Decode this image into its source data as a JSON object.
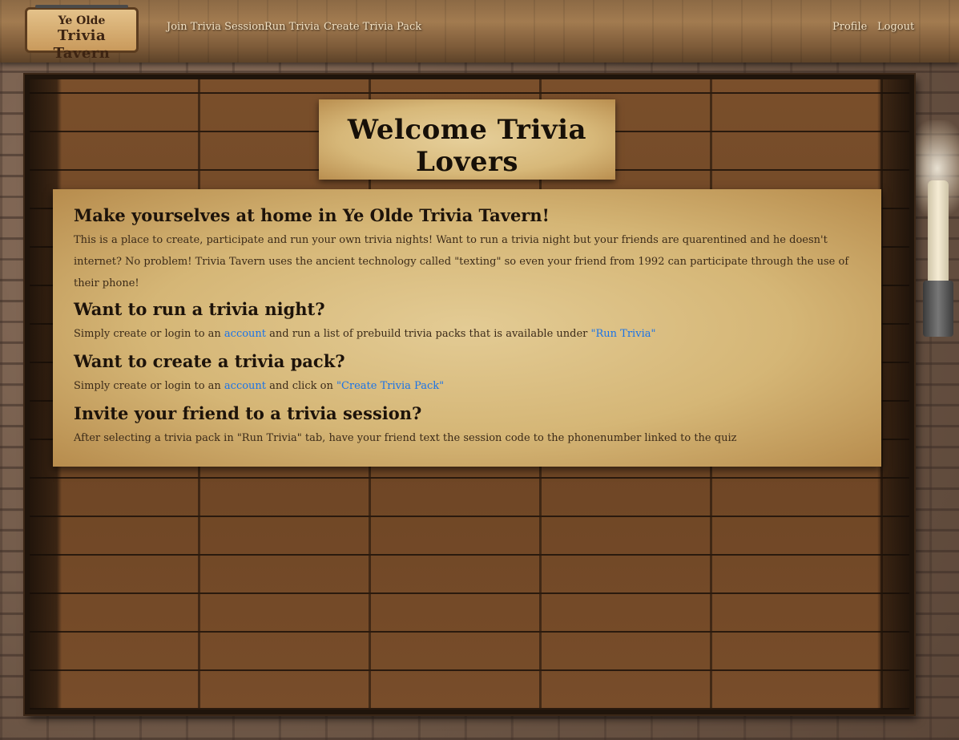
{
  "logo": {
    "line1": "Ye Olde",
    "line2": "Trivia Tavern"
  },
  "nav": {
    "links": [
      {
        "label": "Join Trivia Session"
      },
      {
        "label": "Run Trivia"
      },
      {
        "label": "Create Trivia Pack"
      }
    ],
    "right_links": [
      {
        "label": "Profile"
      },
      {
        "label": "Logout"
      }
    ]
  },
  "title": "Welcome Trivia Lovers",
  "main": {
    "heading": "Make yourselves at home in Ye Olde Trivia Tavern!",
    "intro": "This is a place to create, participate and run your own trivia nights! Want to run a trivia night but your friends are quarentined and he doesn't internet? No problem! Trivia Tavern uses the ancient technology called \"texting\" so even your friend from 1992 can participate through the use of their phone!",
    "sections": {
      "run": {
        "heading": "Want to run a trivia night?",
        "text_before": "Simply create or login to an ",
        "link1": "account",
        "text_middle": " and run a list of prebuild trivia packs that is available under ",
        "link2": "\"Run Trivia\""
      },
      "create": {
        "heading": "Want to create a trivia pack?",
        "text_before": "Simply create or login to an ",
        "link1": "account",
        "text_middle": " and click on ",
        "link2": "\"Create Trivia Pack\""
      },
      "invite": {
        "heading": "Invite your friend to a trivia session?",
        "text": "After selecting a trivia pack in \"Run Trivia\" tab, have your friend text the session code to the phonenumber linked to the quiz"
      }
    }
  },
  "colors": {
    "link": "#1a73e8",
    "nav_text": "#f3e2c4",
    "parchment": "#d7b879",
    "wood": "#6e4626"
  }
}
